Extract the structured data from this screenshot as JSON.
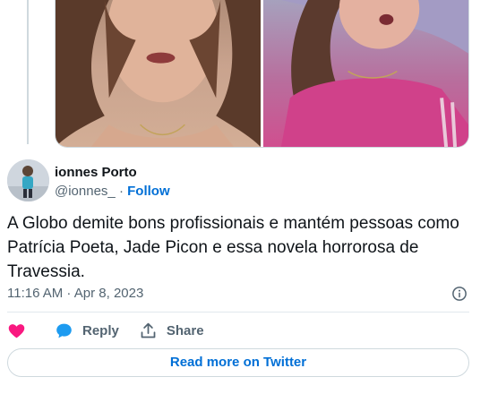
{
  "tweet": {
    "author_name": "ionnes Porto",
    "handle": "@ionnes_",
    "separator": "·",
    "follow_label": "Follow",
    "text": "A Globo demite bons profissionais e mantém pessoas como Patrícia Poeta, Jade Picon e essa novela horrorosa de Travessia.",
    "timestamp": "11:16 AM · Apr 8, 2023"
  },
  "actions": {
    "like_label": "",
    "reply_label": "Reply",
    "share_label": "Share"
  },
  "read_more_label": "Read more on Twitter",
  "icons": {
    "like": "heart-icon",
    "reply": "speech-bubble-icon",
    "share": "share-upload-icon",
    "info": "info-icon"
  },
  "colors": {
    "link": "#006fd6",
    "like": "#f91880",
    "reply": "#1d9bf0",
    "muted": "#536471",
    "border": "#cfd9de"
  }
}
